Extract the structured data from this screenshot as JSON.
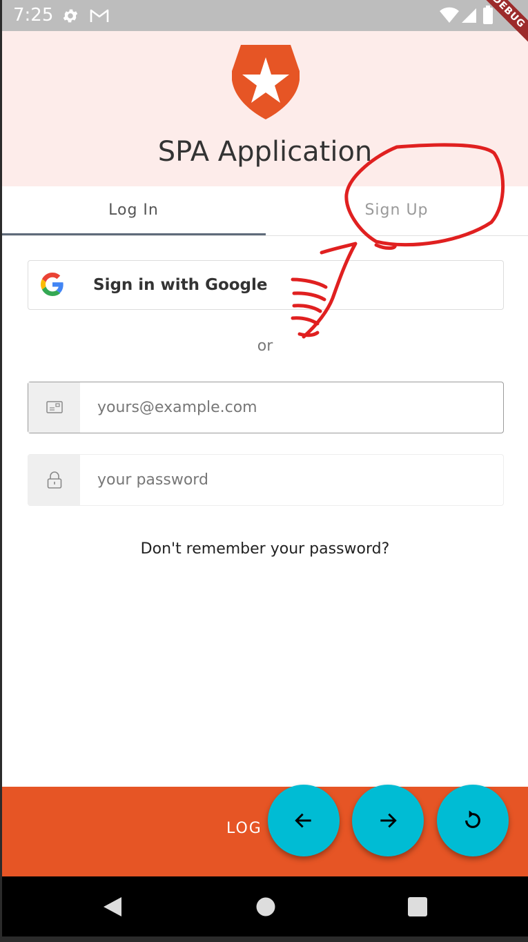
{
  "status_bar": {
    "time": "7:25",
    "debug_label": "DEBUG",
    "icons": [
      "gear-icon",
      "gmail-icon",
      "wifi-icon",
      "signal-icon",
      "battery-icon"
    ]
  },
  "header": {
    "logo": "auth0-logo",
    "title": "SPA Application",
    "background": "#fdecea",
    "logo_color": "#e65525"
  },
  "tabs": [
    {
      "label": "Log In",
      "selected": true
    },
    {
      "label": "Sign Up",
      "selected": false
    }
  ],
  "google_button": {
    "label": "Sign in with Google",
    "icon": "google-icon"
  },
  "divider_text": "or",
  "email": {
    "placeholder": "yours@example.com",
    "value": "",
    "icon": "email-icon"
  },
  "password": {
    "placeholder": "your password",
    "value": "",
    "icon": "lock-icon"
  },
  "forgot_password": "Don't remember your password?",
  "login_button": {
    "label": "LOG IN",
    "color": "#e65525"
  },
  "fabs": [
    {
      "icon": "arrow-back-icon"
    },
    {
      "icon": "arrow-forward-icon"
    },
    {
      "icon": "refresh-icon"
    }
  ],
  "fab_color": "#00bcd4",
  "nav_bar": {
    "buttons": [
      "back-triangle-icon",
      "home-circle-icon",
      "recents-square-icon"
    ]
  }
}
